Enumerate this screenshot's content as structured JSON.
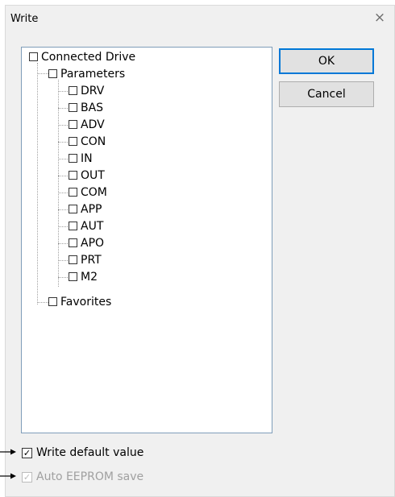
{
  "dialog": {
    "title": "Write",
    "close_glyph": "×"
  },
  "tree": {
    "root": {
      "label": "Connected Drive",
      "checked": false
    },
    "parameters": {
      "label": "Parameters",
      "checked": false,
      "items": [
        "DRV",
        "BAS",
        "ADV",
        "CON",
        "IN",
        "OUT",
        "COM",
        "APP",
        "AUT",
        "APO",
        "PRT",
        "M2"
      ]
    },
    "favorites": {
      "label": "Favorites",
      "checked": false
    }
  },
  "buttons": {
    "ok_label": "OK",
    "cancel_label": "Cancel"
  },
  "options": {
    "write_default": {
      "label": "Write default value",
      "checked": true,
      "enabled": true
    },
    "auto_eeprom": {
      "label": "Auto EEPROM save",
      "checked": true,
      "enabled": false
    }
  },
  "colors": {
    "accent": "#0078d7",
    "tree_border": "#7f9db9",
    "dialog_bg": "#f0f0f0",
    "disabled_text": "#a0a0a0"
  }
}
